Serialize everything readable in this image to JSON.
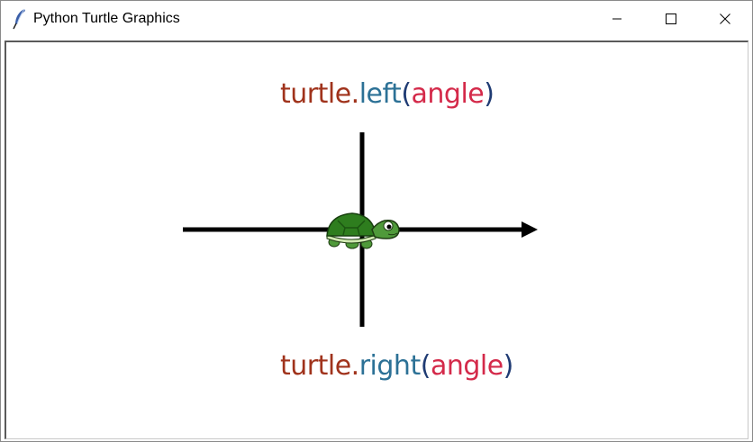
{
  "window": {
    "title": "Python Turtle Graphics",
    "controls": {
      "minimize_icon": "minimize-icon",
      "maximize_icon": "maximize-icon",
      "close_icon": "close-icon"
    }
  },
  "canvas": {
    "top_label": {
      "obj": "turtle",
      "dot": ".",
      "method": "left",
      "open": "(",
      "arg": "angle",
      "close": ")"
    },
    "bottom_label": {
      "obj": "turtle",
      "dot": ".",
      "method": "right",
      "open": "(",
      "arg": "angle",
      "close": ")"
    },
    "colors": {
      "object": "#a0331c",
      "method": "#2c7196",
      "paren": "#1f3b73",
      "argument": "#d42a4a",
      "axis": "#000000",
      "turtle_shell": "#2e7d1e",
      "turtle_skin": "#4f9a3a"
    },
    "icons": {
      "turtle": "turtle-icon",
      "arrow": "arrow-head-icon"
    }
  }
}
